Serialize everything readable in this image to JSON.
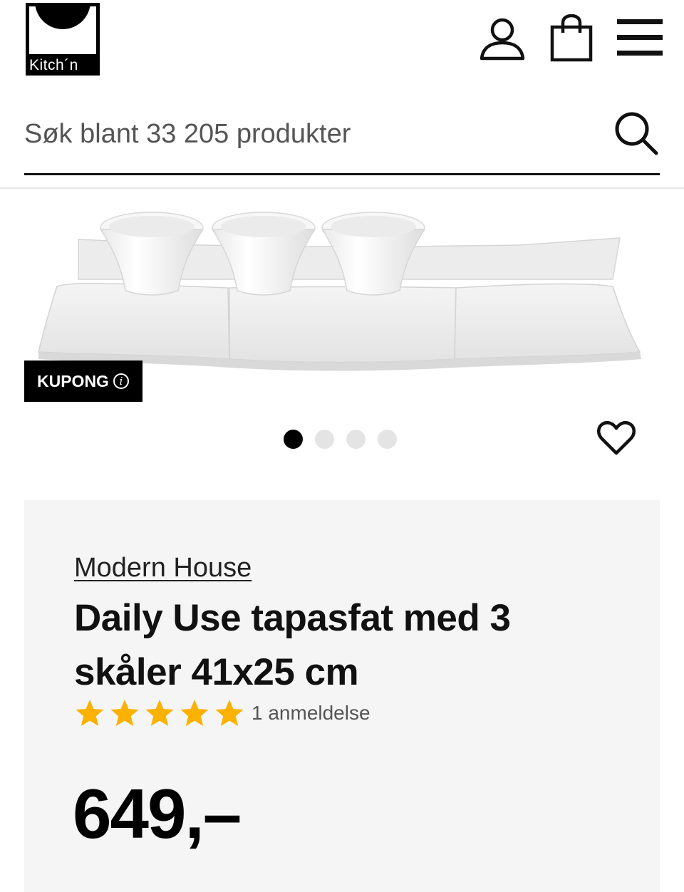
{
  "header": {
    "logo_text": "Kitch´n",
    "icons": [
      "user-icon",
      "shopping-bag-icon",
      "hamburger-menu-icon"
    ]
  },
  "search": {
    "placeholder": "Søk blant 33 205 produkter",
    "icon": "search-icon"
  },
  "gallery": {
    "coupon_label": "KUPONG",
    "info_glyph": "i",
    "dots_total": 4,
    "active_dot": 1,
    "wishlist_icon": "heart-icon"
  },
  "product": {
    "brand": "Modern House",
    "title": "Daily Use tapasfat med 3 skåler 41x25 cm",
    "rating": 5,
    "rating_max": 5,
    "review_count": "1 anmeldelse",
    "price": "649,–"
  },
  "colors": {
    "star": "#fbb100",
    "panel_bg": "#f5f5f5",
    "coupon_bg": "#000000",
    "dot_inactive": "#e4e4e4"
  }
}
